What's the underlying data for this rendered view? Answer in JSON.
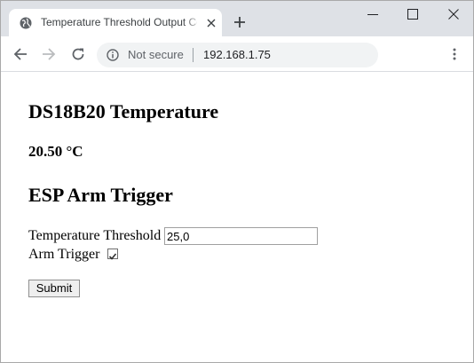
{
  "browser": {
    "tab_title": "Temperature Threshold Output Control",
    "security_label": "Not secure",
    "url": "192.168.1.75"
  },
  "page": {
    "sensor_heading": "DS18B20 Temperature",
    "temperature_reading": "20.50 °C",
    "trigger_heading": "ESP Arm Trigger",
    "threshold_label": "Temperature Threshold",
    "threshold_value": "25,0",
    "arm_label": "Arm Trigger",
    "arm_checked": true,
    "submit_label": "Submit"
  },
  "colors": {
    "tabstrip": "#dee1e6",
    "omnibox": "#f1f3f4",
    "icon": "#5f6368"
  }
}
